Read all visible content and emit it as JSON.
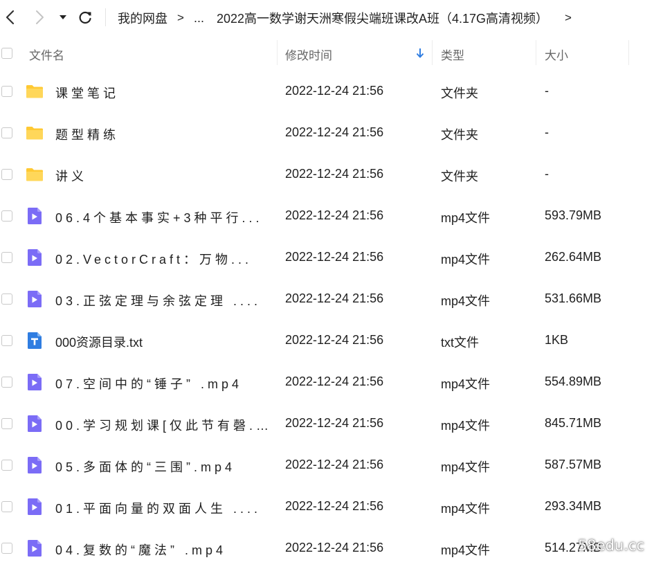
{
  "nav": {
    "back_icon": "chevron-left-icon",
    "forward_icon": "chevron-right-icon",
    "dropdown_icon": "caret-down-icon",
    "refresh_icon": "refresh-icon"
  },
  "breadcrumb": {
    "root": "我的网盘",
    "separator": ">",
    "ellipsis": "...",
    "current": "2022高一数学谢天洲寒假尖端班课改A班（4.17G高清视频）",
    "tail_separator": ">"
  },
  "header": {
    "name": "文件名",
    "time": "修改时间",
    "type": "类型",
    "size": "大小",
    "sort_icon": "arrow-down-icon",
    "sort_color": "#2f7de1"
  },
  "colors": {
    "folder": "#ffc933",
    "video": "#7b6cf6",
    "text_file": "#2f7de1"
  },
  "rows": [
    {
      "name": "课堂笔记",
      "time": "2022-12-24 21:56",
      "type": "文件夹",
      "size": "-",
      "icon": "folder-icon"
    },
    {
      "name": "题型精练",
      "time": "2022-12-24 21:56",
      "type": "文件夹",
      "size": "-",
      "icon": "folder-icon"
    },
    {
      "name": "讲义",
      "time": "2022-12-24 21:56",
      "type": "文件夹",
      "size": "-",
      "icon": "folder-icon"
    },
    {
      "name": "06.4个基本事实+3种平行...",
      "time": "2022-12-24 21:56",
      "type": "mp4文件",
      "size": "593.79MB",
      "icon": "video-file-icon"
    },
    {
      "name": "02.VectorCraft：万物...",
      "time": "2022-12-24 21:56",
      "type": "mp4文件",
      "size": "262.64MB",
      "icon": "video-file-icon"
    },
    {
      "name": "03.正弦定理与余弦定理 ....",
      "time": "2022-12-24 21:56",
      "type": "mp4文件",
      "size": "531.66MB",
      "icon": "video-file-icon"
    },
    {
      "name": "000资源目录.txt",
      "time": "2022-12-24 21:56",
      "type": "txt文件",
      "size": "1KB",
      "icon": "text-file-icon"
    },
    {
      "name": "07.空间中的“锤子” .mp4",
      "time": "2022-12-24 21:56",
      "type": "mp4文件",
      "size": "554.89MB",
      "icon": "video-file-icon"
    },
    {
      "name": "00.学习规划课[仅此节有磬...",
      "time": "2022-12-24 21:56",
      "type": "mp4文件",
      "size": "845.71MB",
      "icon": "video-file-icon"
    },
    {
      "name": "05.多面体的“三围”.mp4",
      "time": "2022-12-24 21:56",
      "type": "mp4文件",
      "size": "587.57MB",
      "icon": "video-file-icon"
    },
    {
      "name": "01.平面向量的双面人生 ....",
      "time": "2022-12-24 21:56",
      "type": "mp4文件",
      "size": "293.34MB",
      "icon": "video-file-icon"
    },
    {
      "name": "04.复数的“魔法” .mp4",
      "time": "2022-12-24 21:56",
      "type": "mp4文件",
      "size": "514.27MB",
      "icon": "video-file-icon"
    }
  ],
  "watermark": "58edu.cc"
}
